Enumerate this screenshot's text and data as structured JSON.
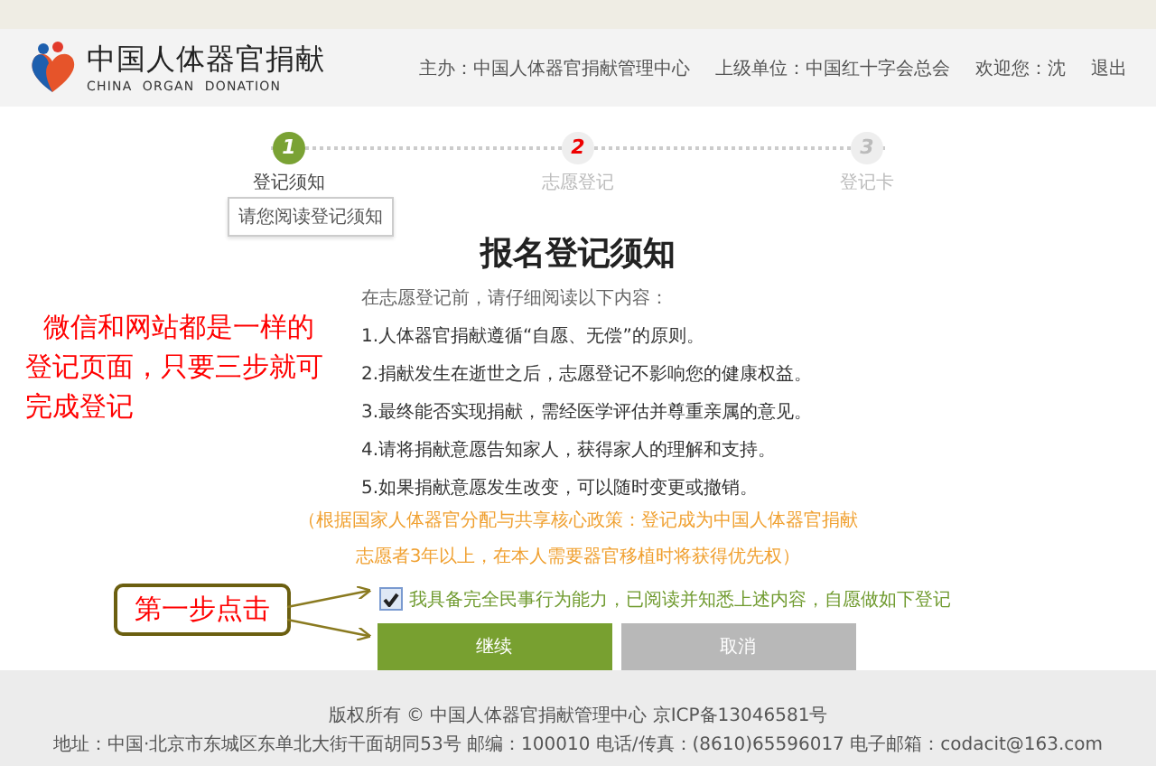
{
  "header": {
    "logo_title": "中国人体器官捐献",
    "logo_subtitle": "CHINA  ORGAN  DONATION",
    "links": [
      "主办：中国人体器官捐献管理中心",
      "上级单位：中国红十字会总会",
      "欢迎您：沈",
      "退出"
    ]
  },
  "steps": [
    {
      "number": "1",
      "label": "登记须知",
      "selected": true,
      "highlighted": false
    },
    {
      "number": "2",
      "label": "志愿登记",
      "selected": false,
      "highlighted": true
    },
    {
      "number": "3",
      "label": "登记卡",
      "selected": false,
      "highlighted": false
    }
  ],
  "tooltip": "请您阅读登记须知",
  "notice": {
    "title": "报名登记须知",
    "intro": "在志愿登记前，请仔细阅读以下内容：",
    "items": [
      "1.人体器官捐献遵循“自愿、无偿”的原则。",
      "2.捐献发生在逝世之后，志愿登记不影响您的健康权益。",
      "3.最终能否实现捐献，需经医学评估并尊重亲属的意见。",
      "4.请将捐献意愿告知家人，获得家人的理解和支持。",
      "5.如果捐献意愿发生改变，可以随时变更或撤销。"
    ],
    "policy": "（根据国家人体器官分配与共享核心政策：登记成为中国人体器官捐献志愿者3年以上，在本人需要器官移植时将获得优先权）"
  },
  "agreement": {
    "label": "我具备完全民事行为能力，已阅读并知悉上述内容，自愿做如下登记",
    "checked": true
  },
  "buttons": [
    {
      "label": "继续",
      "kind": "primary"
    },
    {
      "label": "取消",
      "kind": "secondary"
    }
  ],
  "footer": [
    "版权所有 © 中国人体器官捐献管理中心 京ICP备13046581号",
    "地址：中国·北京市东城区东单北大街干面胡同53号 邮编：100010 电话/传真：(8610)65596017 电子邮箱：codacit@163.com"
  ],
  "annotations": {
    "note": "微信和网站都是一样的登记页面，只要三步就可完成登记",
    "callout": "第一步点击"
  }
}
